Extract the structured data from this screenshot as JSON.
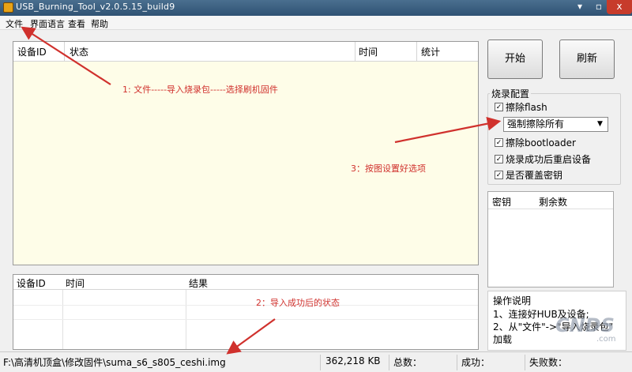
{
  "window": {
    "title": "USB_Burning_Tool_v2.0.5.15_build9",
    "minimize": "▾",
    "maximize": "▫",
    "close": "x"
  },
  "menu": [
    {
      "label": "文件"
    },
    {
      "label": "界面语言"
    },
    {
      "label": "查看"
    },
    {
      "label": "帮助"
    }
  ],
  "main_table": {
    "columns": [
      "设备ID",
      "状态",
      "时间",
      "统计"
    ]
  },
  "buttons": {
    "start": "开始",
    "refresh": "刷新"
  },
  "config": {
    "title": "烧录配置",
    "erase_flash": {
      "label": "擦除flash",
      "checked": true
    },
    "erase_mode": "强制擦除所有",
    "erase_bootloader": {
      "label": "擦除bootloader",
      "checked": true
    },
    "reboot_after": {
      "label": "烧录成功后重启设备",
      "checked": true
    },
    "overwrite_key": {
      "label": "是否覆盖密钥",
      "checked": true
    }
  },
  "key_table": {
    "columns": [
      "密钥",
      "剩余数"
    ]
  },
  "log_table": {
    "columns": [
      "设备ID",
      "时间",
      "结果"
    ]
  },
  "instructions": {
    "title": "操作说明",
    "line1": "1、连接好HUB及设备;",
    "line2": "2、从\"文件\"->\"导入烧录包\"",
    "line3": "加载"
  },
  "status": {
    "path": "F:\\高清机顶盒\\修改固件\\suma_s6_s805_ceshi.img",
    "size": "362,218 KB",
    "total": "总数：",
    "success": "成功：",
    "fail": "失败数："
  },
  "annotations": {
    "a1": "1: 文件-----导入烧录包-----选择刷机固件",
    "a2": "2：导入成功后的状态",
    "a3": "3：按图设置好选项"
  },
  "watermark": {
    "text": "CNDS",
    "sub": ".com"
  },
  "colors": {
    "annotation": "#d0312d",
    "table_bg": "#fefde8",
    "titlebar": "#3a5f80"
  }
}
